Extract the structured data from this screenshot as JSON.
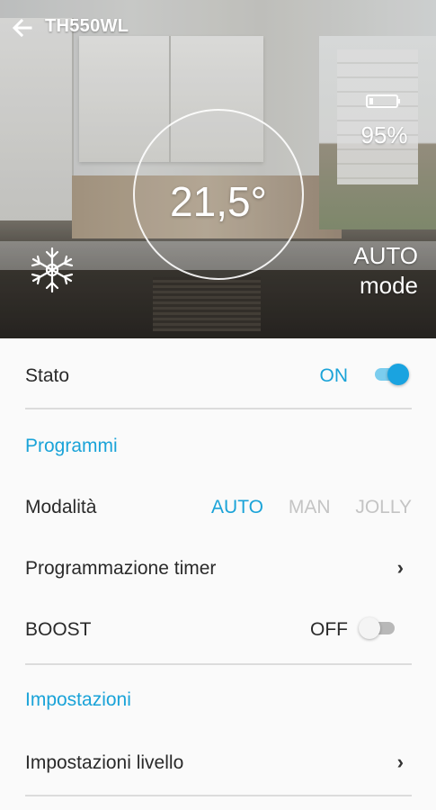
{
  "header": {
    "title": "TH550WL",
    "back_icon": "arrow-left-icon"
  },
  "status_panel": {
    "temperature": "21,5°",
    "battery_percent": "95%",
    "battery_icon": "battery-icon",
    "mode_line1": "AUTO",
    "mode_line2": "mode",
    "mode_icon": "snowflake-icon"
  },
  "settings": {
    "stato": {
      "label": "Stato",
      "value": "ON",
      "state": "on"
    },
    "programmi_section": "Programmi",
    "modalita": {
      "label": "Modalità",
      "options": [
        "AUTO",
        "MAN",
        "JOLLY"
      ],
      "selected": "AUTO"
    },
    "programmazione_timer": {
      "label": "Programmazione timer",
      "chevron": "›"
    },
    "boost": {
      "label": "BOOST",
      "value": "OFF",
      "state": "off"
    },
    "impostazioni_section": "Impostazioni",
    "impostazioni_livello": {
      "label": "Impostazioni livello",
      "chevron": "›"
    }
  },
  "colors": {
    "accent": "#1aa3d8",
    "text": "#2a2a2a",
    "inactive_option": "#c4c4c4",
    "divider": "#dcdcdc"
  }
}
